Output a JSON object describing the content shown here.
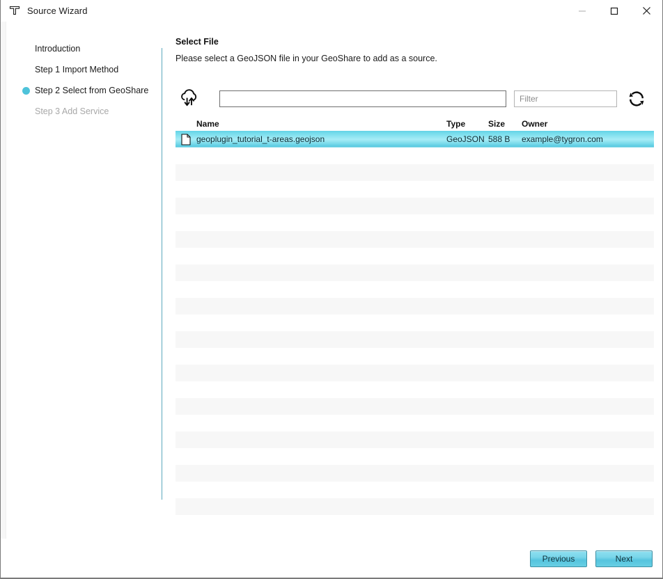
{
  "window": {
    "title": "Source Wizard",
    "logo_icon": "tygron-t-logo-icon",
    "controls": {
      "minimize_icon": "minimize-icon",
      "maximize_icon": "maximize-icon",
      "close_icon": "close-icon"
    }
  },
  "sidebar": {
    "steps": [
      {
        "label": "Introduction",
        "state": "done"
      },
      {
        "label": "Step 1 Import Method",
        "state": "done"
      },
      {
        "label": "Step 2 Select from GeoShare",
        "state": "current"
      },
      {
        "label": "Step 3 Add Service",
        "state": "disabled"
      }
    ],
    "current_marker_color": "#4ec3da"
  },
  "main": {
    "title": "Select File",
    "description": "Please select a GeoJSON file in your GeoShare to add as a source."
  },
  "toolbar": {
    "cloud_icon": "cloud-transfer-icon",
    "refresh_icon": "refresh-icon",
    "search": {
      "value": "",
      "placeholder": ""
    },
    "filter": {
      "value": "",
      "placeholder": "Filter"
    }
  },
  "table": {
    "columns": [
      {
        "key": "name",
        "label": "Name"
      },
      {
        "key": "type",
        "label": "Type"
      },
      {
        "key": "size",
        "label": "Size"
      },
      {
        "key": "owner",
        "label": "Owner"
      }
    ],
    "rows": [
      {
        "icon": "file-icon",
        "name": "geoplugin_tutorial_t-areas.geojson",
        "type": "GeoJSON",
        "size": "588 B",
        "owner": "example@tygron.com",
        "selected": true
      }
    ],
    "empty_row_count": 23,
    "selected_row_color": "#7fe0ee",
    "stripe_color": "#f7f7f7"
  },
  "footer": {
    "previous_label": "Previous",
    "next_label": "Next",
    "accent_color": "#55c4de"
  }
}
